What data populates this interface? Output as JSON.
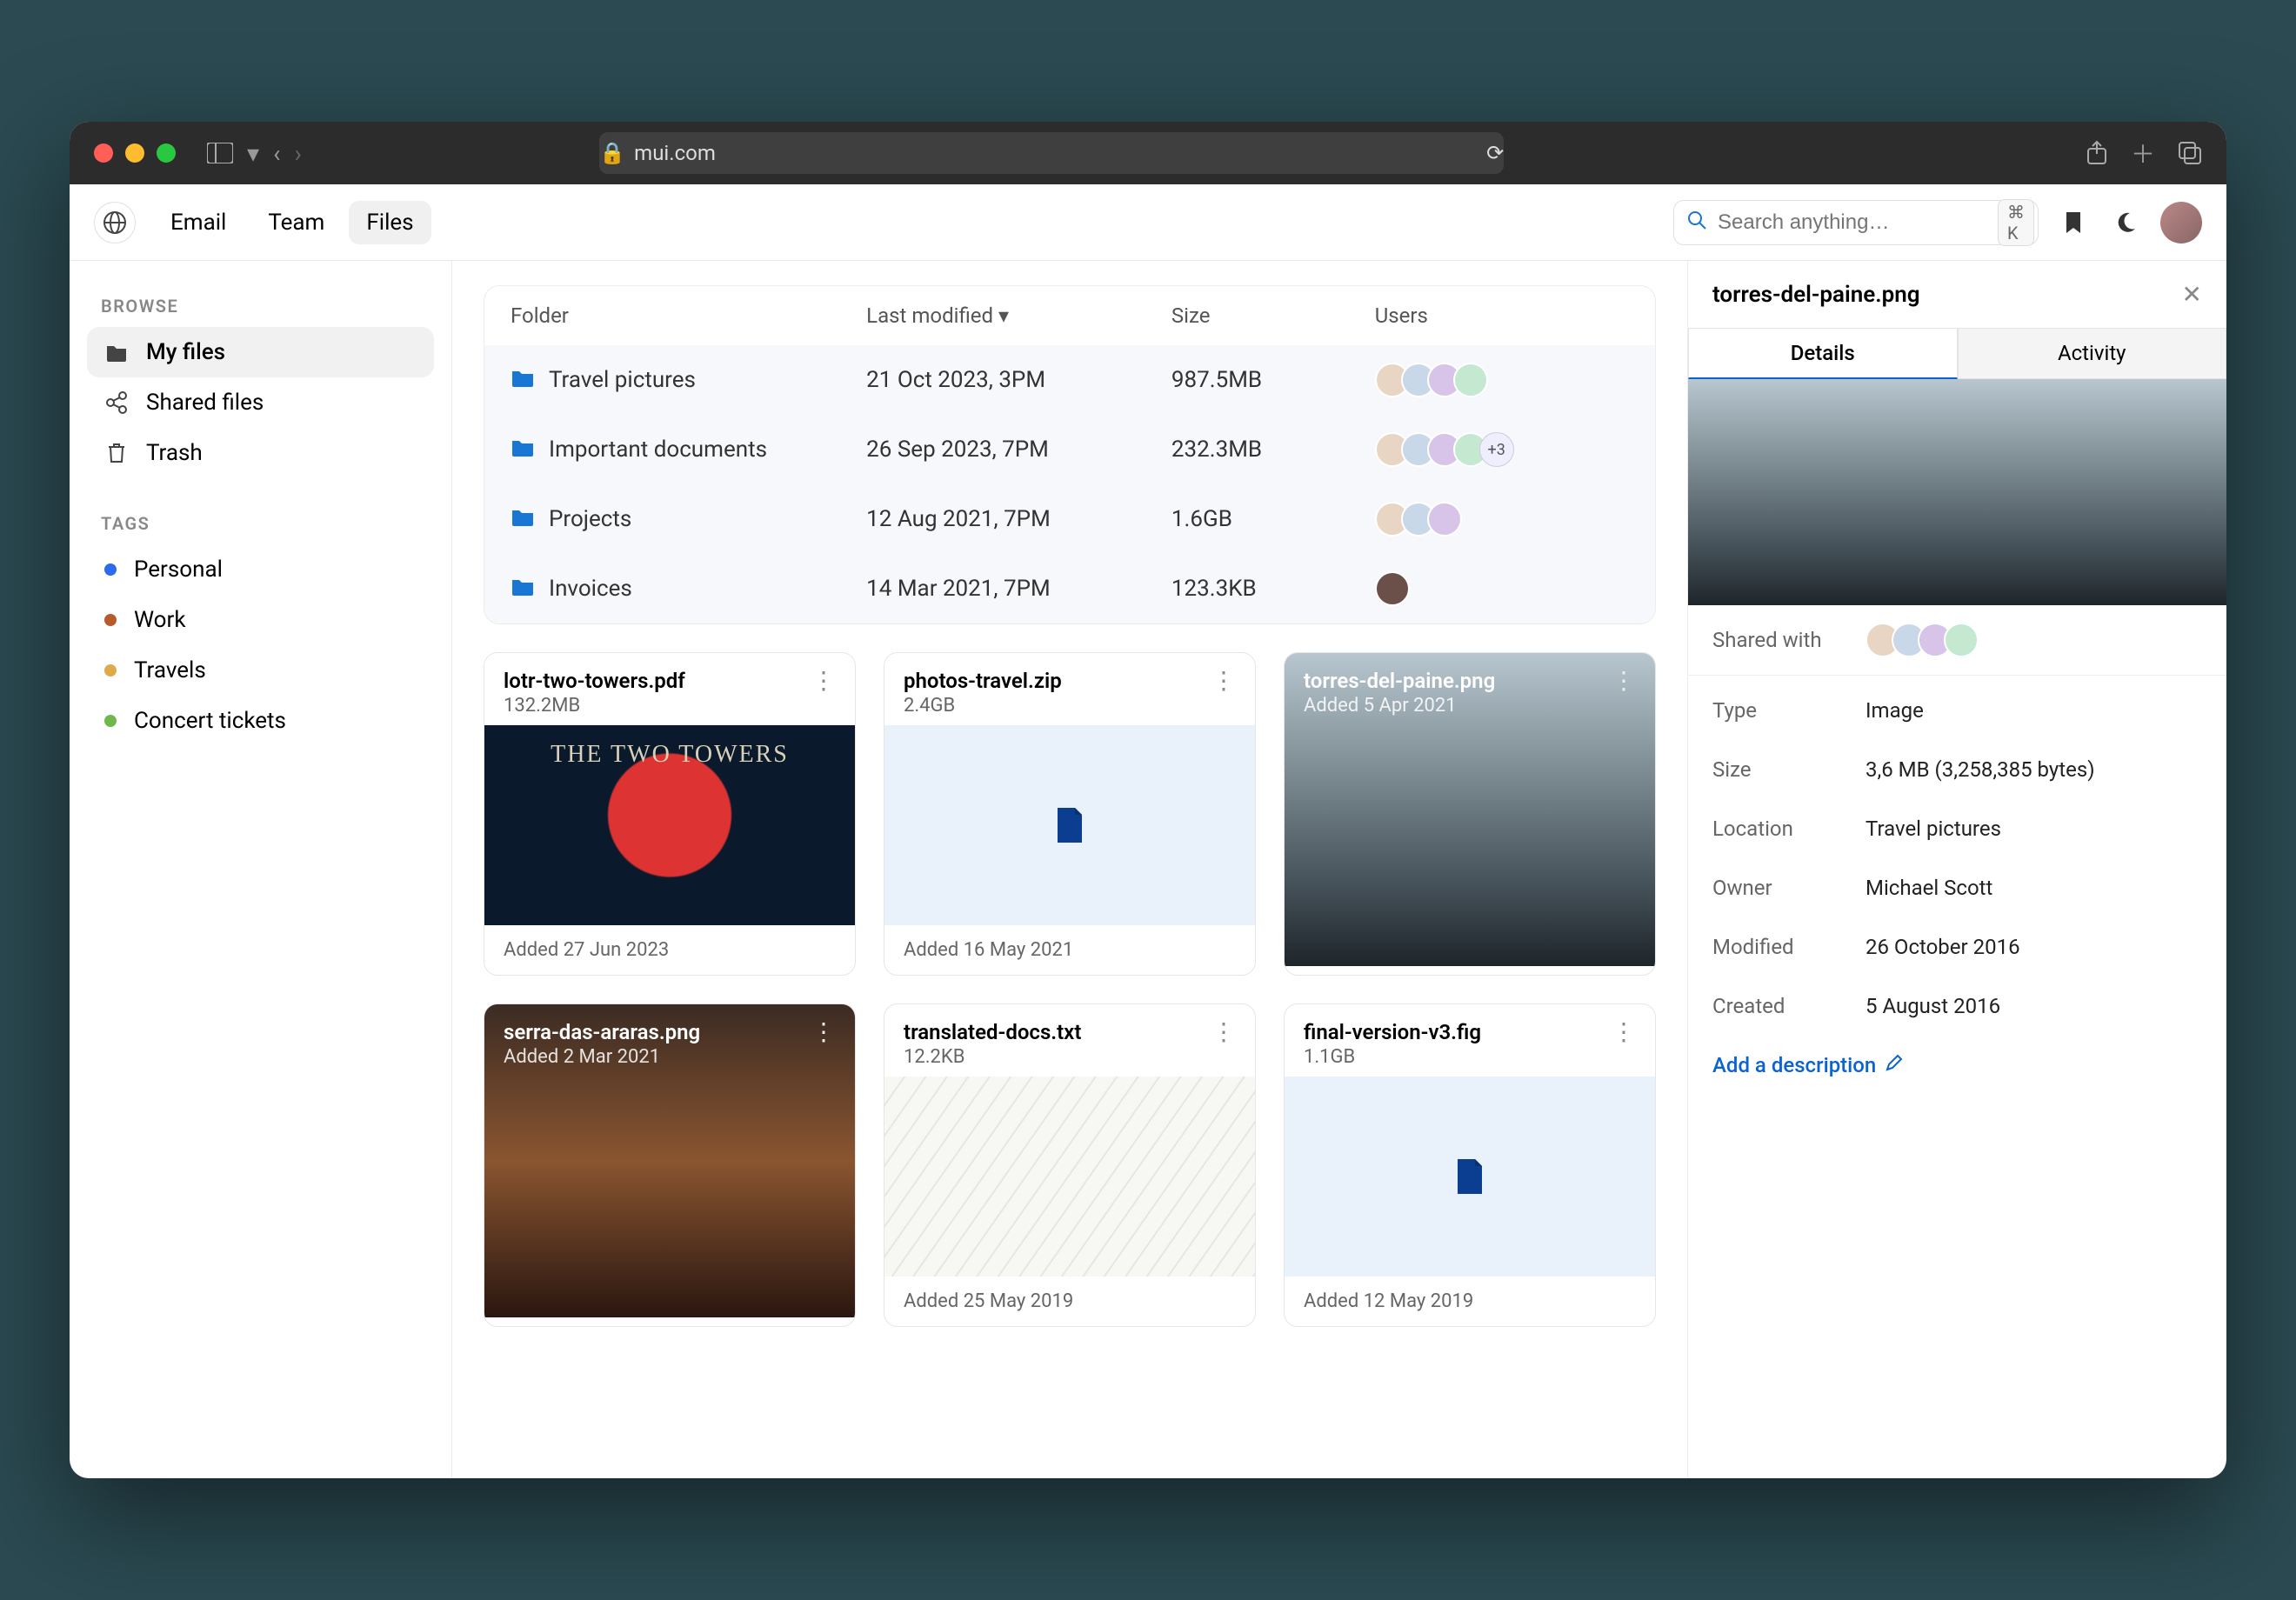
{
  "browser": {
    "url_host": "mui.com"
  },
  "header": {
    "tabs": [
      "Email",
      "Team",
      "Files"
    ],
    "active_tab": 2,
    "search_placeholder": "Search anything…",
    "search_shortcut": "⌘ K"
  },
  "sidebar": {
    "browse_label": "BROWSE",
    "browse": [
      {
        "icon": "folder",
        "label": "My files",
        "active": true
      },
      {
        "icon": "share",
        "label": "Shared files"
      },
      {
        "icon": "trash",
        "label": "Trash"
      }
    ],
    "tags_label": "TAGS",
    "tags": [
      {
        "color": "#2b6bed",
        "label": "Personal"
      },
      {
        "color": "#b85b2a",
        "label": "Work"
      },
      {
        "color": "#e0a94b",
        "label": "Travels"
      },
      {
        "color": "#6fb84e",
        "label": "Concert tickets"
      }
    ]
  },
  "table": {
    "headers": [
      "Folder",
      "Last modified",
      "Size",
      "Users"
    ],
    "sort_col": 1,
    "rows": [
      {
        "name": "Travel pictures",
        "modified": "21 Oct 2023, 3PM",
        "size": "987.5MB",
        "users": 4,
        "extra": 0
      },
      {
        "name": "Important documents",
        "modified": "26 Sep 2023, 7PM",
        "size": "232.3MB",
        "users": 4,
        "extra": 3
      },
      {
        "name": "Projects",
        "modified": "12 Aug 2021, 7PM",
        "size": "1.6GB",
        "users": 3,
        "extra": 0
      },
      {
        "name": "Invoices",
        "modified": "14 Mar 2021, 7PM",
        "size": "123.3KB",
        "users": 1,
        "extra": 0
      }
    ]
  },
  "cards": [
    {
      "title": "lotr-two-towers.pdf",
      "sub": "132.2MB",
      "footer": "Added 27 Jun 2023",
      "thumb": "book",
      "mode": "light"
    },
    {
      "title": "photos-travel.zip",
      "sub": "2.4GB",
      "footer": "Added 16 May 2021",
      "thumb": "fileph",
      "mode": "light"
    },
    {
      "title": "torres-del-paine.png",
      "sub": "Added 5 Apr 2021",
      "footer": "",
      "thumb": "mntn",
      "mode": "overlay"
    },
    {
      "title": "serra-das-araras.png",
      "sub": "Added 2 Mar 2021",
      "footer": "",
      "thumb": "sunset",
      "mode": "overlay"
    },
    {
      "title": "translated-docs.txt",
      "sub": "12.2KB",
      "footer": "Added 25 May 2019",
      "thumb": "papers",
      "mode": "light"
    },
    {
      "title": "final-version-v3.fig",
      "sub": "1.1GB",
      "footer": "Added 12 May 2019",
      "thumb": "fileph",
      "mode": "light"
    }
  ],
  "details": {
    "filename": "torres-del-paine.png",
    "tabs": [
      "Details",
      "Activity"
    ],
    "active_tab": 0,
    "shared_label": "Shared with",
    "shared_count": 4,
    "rows": [
      {
        "k": "Type",
        "v": "Image"
      },
      {
        "k": "Size",
        "v": "3,6 MB (3,258,385 bytes)"
      },
      {
        "k": "Location",
        "v": "Travel pictures"
      },
      {
        "k": "Owner",
        "v": "Michael Scott"
      },
      {
        "k": "Modified",
        "v": "26 October 2016"
      },
      {
        "k": "Created",
        "v": "5 August 2016"
      }
    ],
    "add_desc": "Add a description"
  }
}
